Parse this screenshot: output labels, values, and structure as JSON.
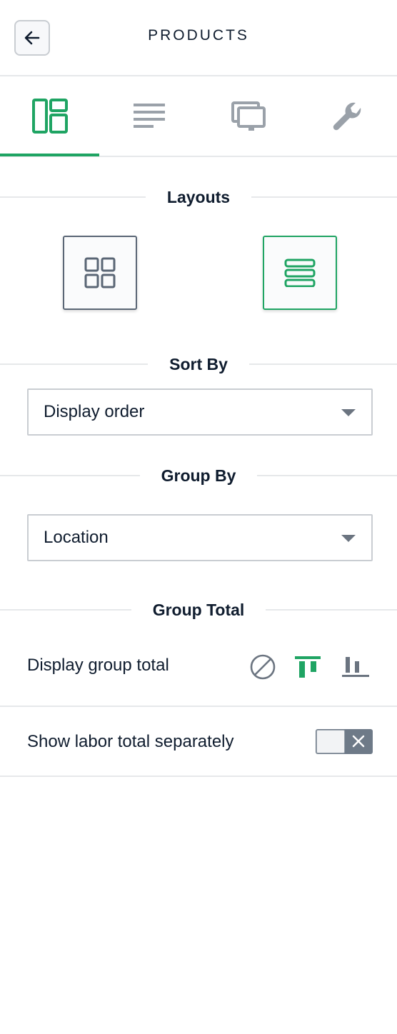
{
  "header": {
    "title": "PRODUCTS",
    "back_icon": "arrow-left-icon"
  },
  "tabs": [
    {
      "icon": "layout-panels-icon",
      "active": true
    },
    {
      "icon": "text-lines-icon",
      "active": false
    },
    {
      "icon": "monitors-icon",
      "active": false
    },
    {
      "icon": "wrench-icon",
      "active": false
    }
  ],
  "layouts": {
    "heading": "Layouts",
    "options": [
      {
        "icon": "grid-layout-icon",
        "selected": false
      },
      {
        "icon": "list-layout-icon",
        "selected": true
      }
    ]
  },
  "sort_by": {
    "heading": "Sort By",
    "value": "Display order"
  },
  "group_by": {
    "heading": "Group By",
    "value": "Location"
  },
  "group_total": {
    "heading": "Group Total",
    "display_label": "Display group total",
    "display_options": [
      {
        "icon": "none-icon",
        "selected": false
      },
      {
        "icon": "total-top-icon",
        "selected": true
      },
      {
        "icon": "total-bottom-icon",
        "selected": false
      }
    ],
    "labor_label": "Show labor total separately",
    "labor_enabled": false
  },
  "colors": {
    "accent": "#1fa463",
    "text": "#0f1c2e",
    "icon_gray": "#9aa1a9",
    "divider": "#e6e8ea"
  }
}
